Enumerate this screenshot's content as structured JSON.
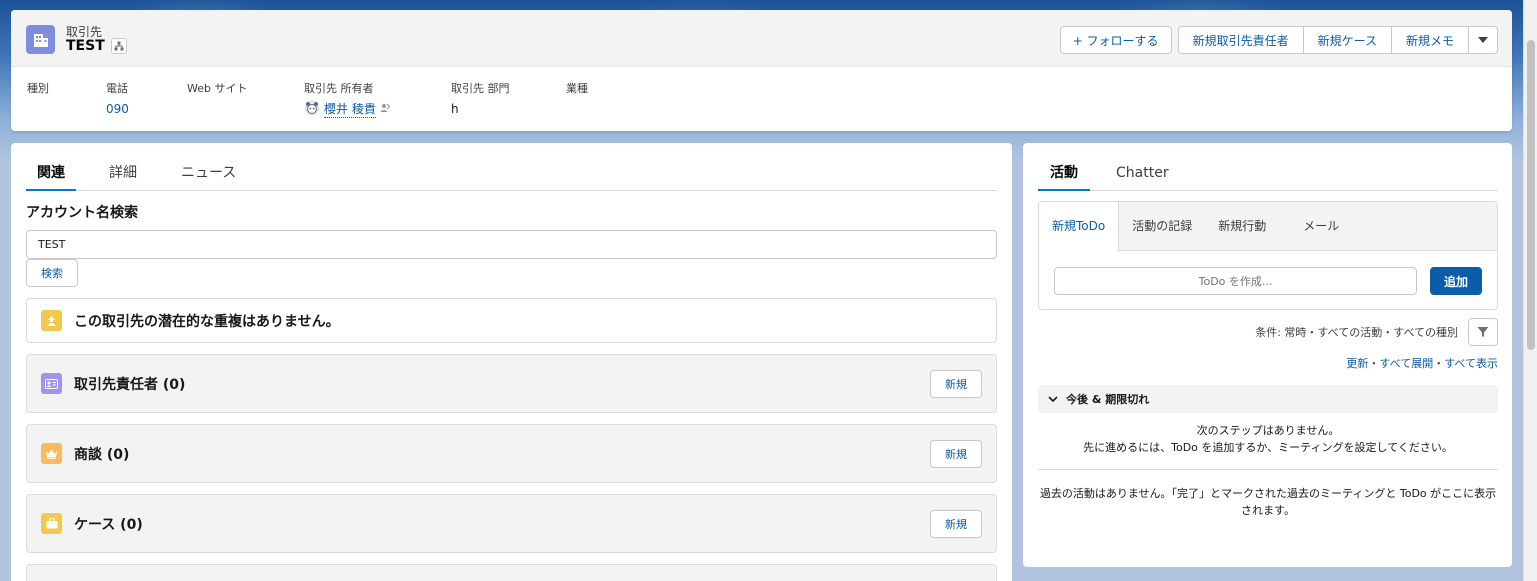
{
  "record": {
    "object_type": "取引先",
    "name": "TEST"
  },
  "actions": {
    "follow": "+ フォローする",
    "new_contact": "新規取引先責任者",
    "new_case": "新規ケース",
    "new_note": "新規メモ"
  },
  "highlights": [
    {
      "label": "種別",
      "value": ""
    },
    {
      "label": "電話",
      "value": "090"
    },
    {
      "label": "Web サイト",
      "value": ""
    },
    {
      "label": "取引先 所有者",
      "value": "櫻井 稜貴"
    },
    {
      "label": "取引先 部門",
      "value": "h"
    },
    {
      "label": "業種",
      "value": ""
    }
  ],
  "left": {
    "tabs": [
      "関連",
      "詳細",
      "ニュース"
    ],
    "search_title": "アカウント名検索",
    "search_value": "TEST",
    "search_button": "検索",
    "duplicate_message": "この取引先の潜在的な重複はありません。",
    "related_lists": [
      {
        "title": "取引先責任者 (0)",
        "new_label": "新規",
        "icon": "contact-card-icon",
        "color": "#a094ed"
      },
      {
        "title": "商談 (0)",
        "new_label": "新規",
        "icon": "crown-icon",
        "color": "#fcb95b"
      },
      {
        "title": "ケース (0)",
        "new_label": "新規",
        "icon": "briefcase-icon",
        "color": "#f4c84e"
      }
    ]
  },
  "right": {
    "tabs": [
      "活動",
      "Chatter"
    ],
    "composer_tabs": [
      "新規ToDo",
      "活動の記録",
      "新規行動",
      "メール"
    ],
    "todo_placeholder": "ToDo を作成...",
    "add_button": "追加",
    "filter_text": "条件: 常時・すべての活動・すべての種別",
    "link_refresh": "更新",
    "link_expand": "すべて展開",
    "link_show_all": "すべて表示",
    "upcoming_label": "今後 & 期限切れ",
    "no_next_line1": "次のステップはありません。",
    "no_next_line2": "先に進めるには、ToDo を追加するか、ミーティングを設定してください。",
    "no_past": "過去の活動はありません。「完了」とマークされた過去のミーティングと ToDo がここに表示されます。"
  },
  "colors": {
    "brand": "#0b5cab",
    "account_icon": "#7f8de1",
    "duplicate_icon": "#f4c84e"
  }
}
